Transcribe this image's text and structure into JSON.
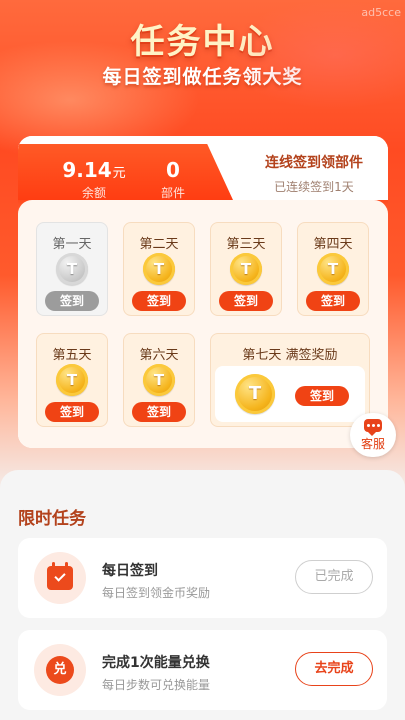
{
  "watermark": "ad5cce",
  "hero": {
    "title": "任务中心",
    "subtitle": "每日签到做任务领大奖"
  },
  "summary": {
    "balance_value": "9.14",
    "balance_unit": "元",
    "balance_label": "余额",
    "parts_value": "0",
    "parts_label": "部件",
    "streak_title": "连线签到领部件",
    "streak_status": "已连续签到1天"
  },
  "days": [
    {
      "label": "第一天",
      "coin": "T",
      "button": "签到",
      "state": "signed"
    },
    {
      "label": "第二天",
      "coin": "T",
      "button": "签到",
      "state": "pending"
    },
    {
      "label": "第三天",
      "coin": "T",
      "button": "签到",
      "state": "pending"
    },
    {
      "label": "第四天",
      "coin": "T",
      "button": "签到",
      "state": "pending"
    },
    {
      "label": "第五天",
      "coin": "T",
      "button": "签到",
      "state": "pending"
    },
    {
      "label": "第六天",
      "coin": "T",
      "button": "签到",
      "state": "pending"
    },
    {
      "label": "第七天 满签奖励",
      "coin": "T",
      "button": "签到",
      "state": "pending"
    }
  ],
  "service": {
    "label": "客服",
    "icon": "chat-bubble-icon"
  },
  "tasks_section": {
    "title": "限时任务",
    "tasks": [
      {
        "name": "每日签到",
        "desc": "每日签到领金币奖励",
        "button": "已完成",
        "icon": "calendar-check-icon",
        "state": "done"
      },
      {
        "name": "完成1次能量兑换",
        "desc": "每日步数可兑换能量",
        "button": "去完成",
        "icon": "exchange-icon",
        "icon_text": "兑",
        "state": "todo"
      }
    ]
  },
  "colors": {
    "accent": "#f04314",
    "title_gold": "#fff3c6",
    "heading_brown": "#b3421c",
    "coin_gold": "#f5b41c"
  }
}
